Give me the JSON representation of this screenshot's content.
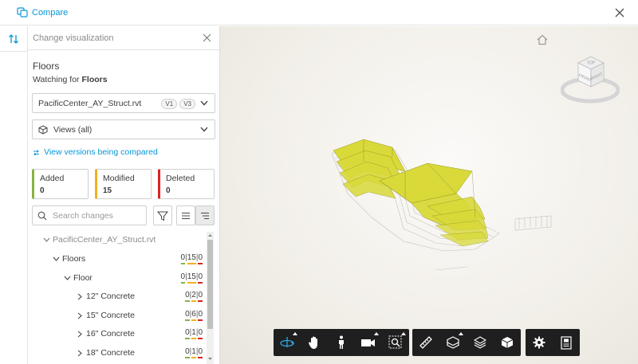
{
  "topbar": {
    "compare_label": "Compare"
  },
  "panel": {
    "header": "Change visualization",
    "section_title": "Floors",
    "watching_prefix": "Watching for",
    "watching_value": "Floors",
    "file_dropdown": {
      "value": "PacificCenter_AY_Struct.rvt",
      "v_from": "V1",
      "v_to": "V3"
    },
    "views_dropdown": {
      "value": "Views (all)"
    },
    "link_label": "View versions being compared",
    "stats": [
      {
        "label": "Added",
        "value": "0"
      },
      {
        "label": "Modified",
        "value": "15"
      },
      {
        "label": "Deleted",
        "value": "0"
      }
    ],
    "search_placeholder": "Search changes",
    "tree": [
      {
        "label": "PacificCenter_AY_Struct.rvt",
        "a": "",
        "m": "",
        "d": ""
      },
      {
        "label": "Floors",
        "a": "0",
        "m": "15",
        "d": "0"
      },
      {
        "label": "Floor",
        "a": "0",
        "m": "15",
        "d": "0"
      },
      {
        "label": "12\" Concrete",
        "a": "0",
        "m": "2",
        "d": "0"
      },
      {
        "label": "15\" Concrete",
        "a": "0",
        "m": "6",
        "d": "0"
      },
      {
        "label": "16\" Concrete",
        "a": "0",
        "m": "1",
        "d": "0"
      },
      {
        "label": "18\" Concrete",
        "a": "0",
        "m": "1",
        "d": "0"
      }
    ]
  },
  "viewer": {
    "viewcube_faces": {
      "top": "TOP",
      "front": "FRONT",
      "right": "RIGHT"
    },
    "toolbar_groups": [
      [
        "orbit-icon",
        "pan-icon",
        "walk-icon",
        "camera-icon",
        "zoom-window-icon"
      ],
      [
        "measure-icon",
        "section-icon",
        "layers-icon",
        "model-browser-icon"
      ],
      [
        "settings-icon",
        "properties-icon"
      ]
    ]
  },
  "colors": {
    "accent": "#0696d7",
    "added": "#87b340",
    "modified": "#f2b01e",
    "deleted": "#dd2222",
    "highlight": "#d9d93a"
  }
}
